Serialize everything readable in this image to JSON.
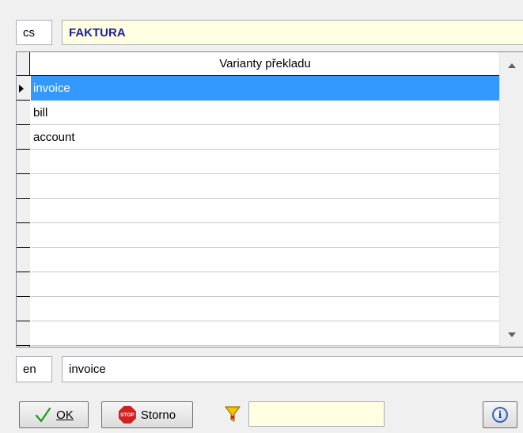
{
  "source": {
    "lang": "cs",
    "word": "FAKTURA"
  },
  "grid": {
    "header": "Varianty překladu",
    "rows": [
      "invoice",
      "bill",
      "account",
      "",
      "",
      "",
      "",
      "",
      "",
      "",
      ""
    ],
    "selected_index": 0
  },
  "target": {
    "lang": "en",
    "word": "invoice"
  },
  "buttons": {
    "ok_label": "OK",
    "storno_label": "Storno",
    "stop_text": "STOP",
    "info_glyph": "i"
  },
  "filter": {
    "value": ""
  },
  "colors": {
    "selection": "#3399ff",
    "source_word": "#1e1ea0",
    "field_yellow": "#ffffe1"
  },
  "icons": [
    "check-icon",
    "stop-icon",
    "filter-icon",
    "info-icon"
  ]
}
